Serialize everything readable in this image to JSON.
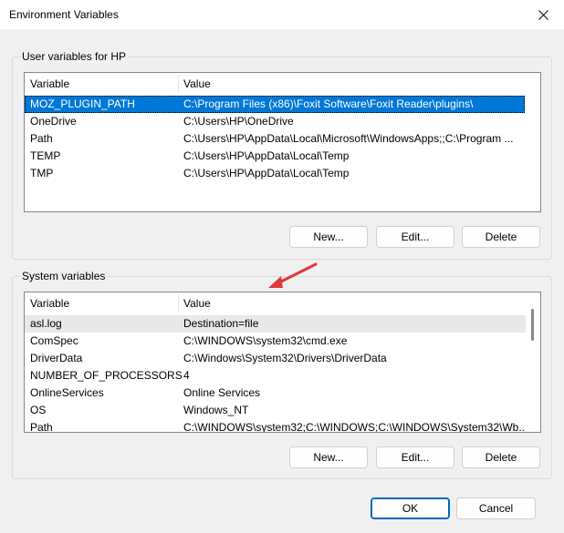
{
  "window": {
    "title": "Environment Variables"
  },
  "user_section": {
    "label": "User variables for HP",
    "columns": [
      "Variable",
      "Value"
    ],
    "rows": [
      {
        "variable": "MOZ_PLUGIN_PATH",
        "value": "C:\\Program Files (x86)\\Foxit Software\\Foxit Reader\\plugins\\",
        "selected": true
      },
      {
        "variable": "OneDrive",
        "value": "C:\\Users\\HP\\OneDrive"
      },
      {
        "variable": "Path",
        "value": "C:\\Users\\HP\\AppData\\Local\\Microsoft\\WindowsApps;;C:\\Program ..."
      },
      {
        "variable": "TEMP",
        "value": "C:\\Users\\HP\\AppData\\Local\\Temp"
      },
      {
        "variable": "TMP",
        "value": "C:\\Users\\HP\\AppData\\Local\\Temp"
      }
    ],
    "buttons": {
      "new": "New...",
      "edit": "Edit...",
      "delete": "Delete"
    }
  },
  "system_section": {
    "label": "System variables",
    "columns": [
      "Variable",
      "Value"
    ],
    "rows": [
      {
        "variable": "asl.log",
        "value": "Destination=file"
      },
      {
        "variable": "ComSpec",
        "value": "C:\\WINDOWS\\system32\\cmd.exe"
      },
      {
        "variable": "DriverData",
        "value": "C:\\Windows\\System32\\Drivers\\DriverData"
      },
      {
        "variable": "NUMBER_OF_PROCESSORS",
        "value": "4"
      },
      {
        "variable": "OnlineServices",
        "value": "Online Services"
      },
      {
        "variable": "OS",
        "value": "Windows_NT"
      },
      {
        "variable": "Path",
        "value": "C:\\WINDOWS\\system32;C:\\WINDOWS;C:\\WINDOWS\\System32\\Wb..."
      }
    ],
    "buttons": {
      "new": "New...",
      "edit": "Edit...",
      "delete": "Delete"
    }
  },
  "footer": {
    "ok": "OK",
    "cancel": "Cancel"
  },
  "colors": {
    "selection": "#0078d7",
    "annotation_arrow": "#e0383e"
  }
}
